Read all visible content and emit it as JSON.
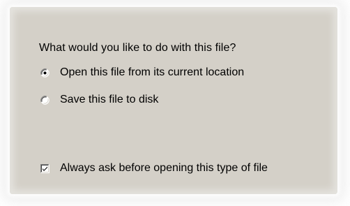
{
  "dialog": {
    "question": "What would you like to do with this file?",
    "options": [
      {
        "label": "Open this file from its current location",
        "selected": true
      },
      {
        "label": "Save this file to disk",
        "selected": false
      }
    ],
    "always_ask": {
      "label": "Always ask before opening this type of file",
      "checked": true
    }
  },
  "colors": {
    "panel_background": "#d4d0c8",
    "text": "#000000"
  }
}
